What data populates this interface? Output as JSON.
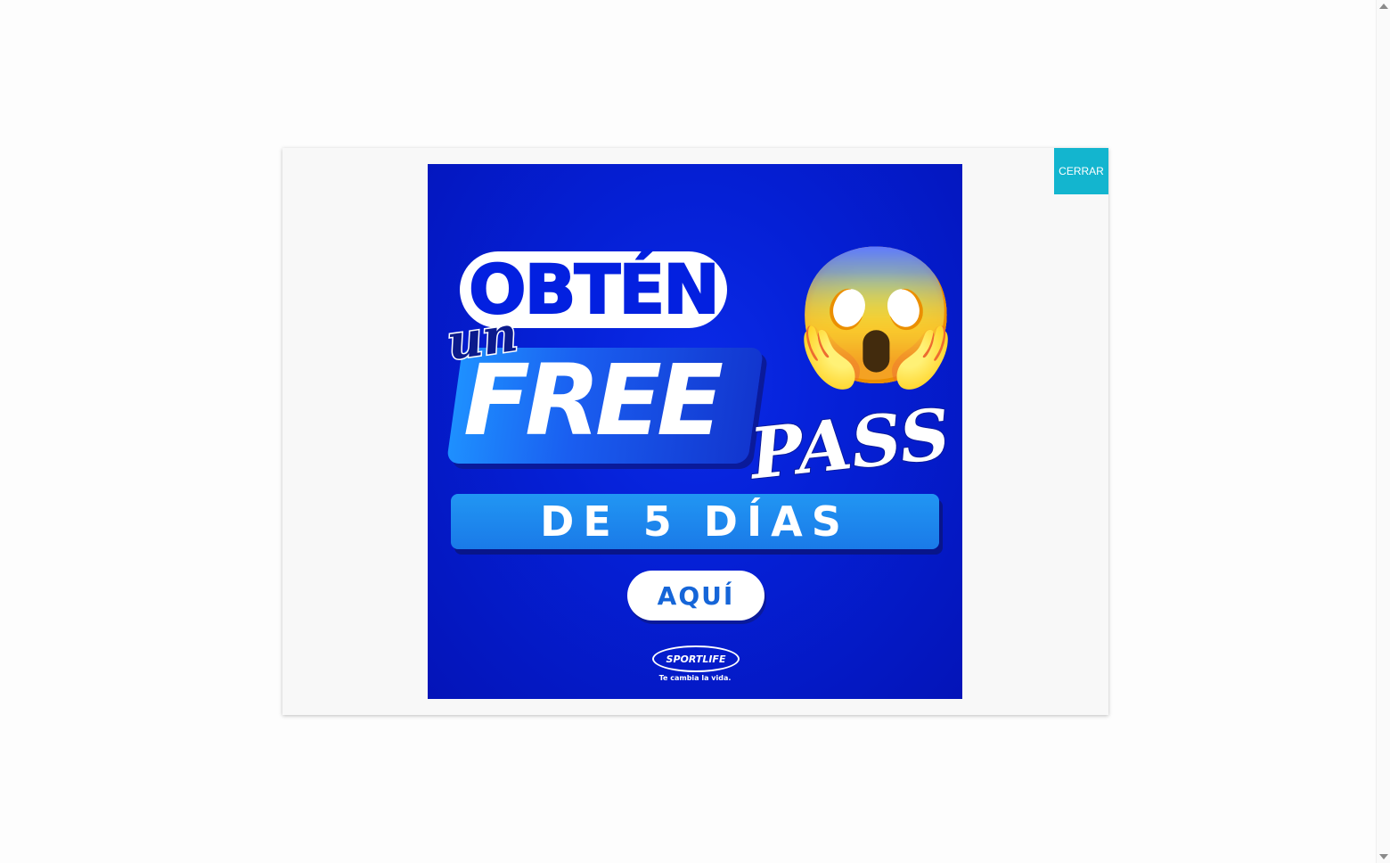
{
  "modal": {
    "close_label": "CERRAR"
  },
  "promo": {
    "headline": "OBTÉN",
    "article": "un",
    "free": "FREE",
    "pass": "PASS",
    "duration": "DE 5 DÍAS",
    "cta": "AQUÍ",
    "emoji": "😱",
    "brand": "SPORTLIFE",
    "tagline": "Te cambia la vida."
  },
  "colors": {
    "close_button": "#13b5cf",
    "banner_blue": "#0520d6",
    "accent_blue": "#1a7ae8"
  }
}
